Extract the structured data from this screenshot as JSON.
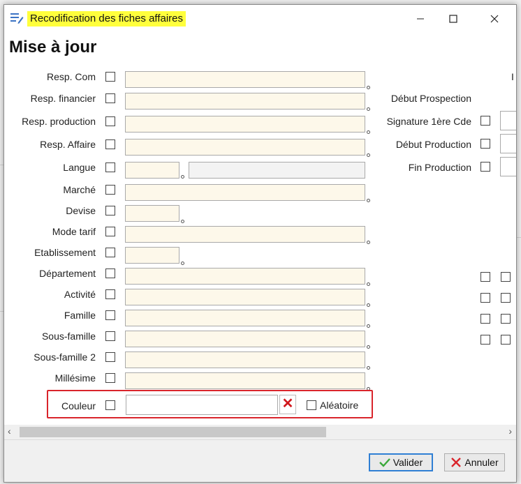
{
  "window": {
    "title": "Recodification des fiches affaires",
    "minimize_icon": "minimize-icon",
    "maximize_icon": "maximize-icon",
    "close_icon": "close-icon"
  },
  "header": {
    "title": "Mise à jour"
  },
  "left_fields": [
    {
      "label": "Resp. Com"
    },
    {
      "label": "Resp. financier"
    },
    {
      "label": "Resp. production"
    },
    {
      "label": "Resp. Affaire"
    },
    {
      "label": "Langue"
    },
    {
      "label": "Marché"
    },
    {
      "label": "Devise"
    },
    {
      "label": "Mode tarif"
    },
    {
      "label": "Etablissement"
    },
    {
      "label": "Département"
    },
    {
      "label": "Activité"
    },
    {
      "label": "Famille"
    },
    {
      "label": "Sous-famille"
    },
    {
      "label": "Sous-famille 2"
    },
    {
      "label": "Millésime"
    }
  ],
  "couleur": {
    "label": "Couleur",
    "value": "",
    "clear_icon": "clear-x-icon",
    "random_label": "Aléatoire"
  },
  "right_fields": [
    {
      "label": "Début Prospection"
    },
    {
      "label": "Signature 1ère Cde"
    },
    {
      "label": "Début Production"
    },
    {
      "label": "Fin Production"
    }
  ],
  "footer": {
    "validate_label": "Valider",
    "cancel_label": "Annuler"
  },
  "colors": {
    "highlight": "#ffff3c",
    "field_bg": "#fdf8ea",
    "accent": "#2f7fd4",
    "danger": "#d9242b"
  }
}
